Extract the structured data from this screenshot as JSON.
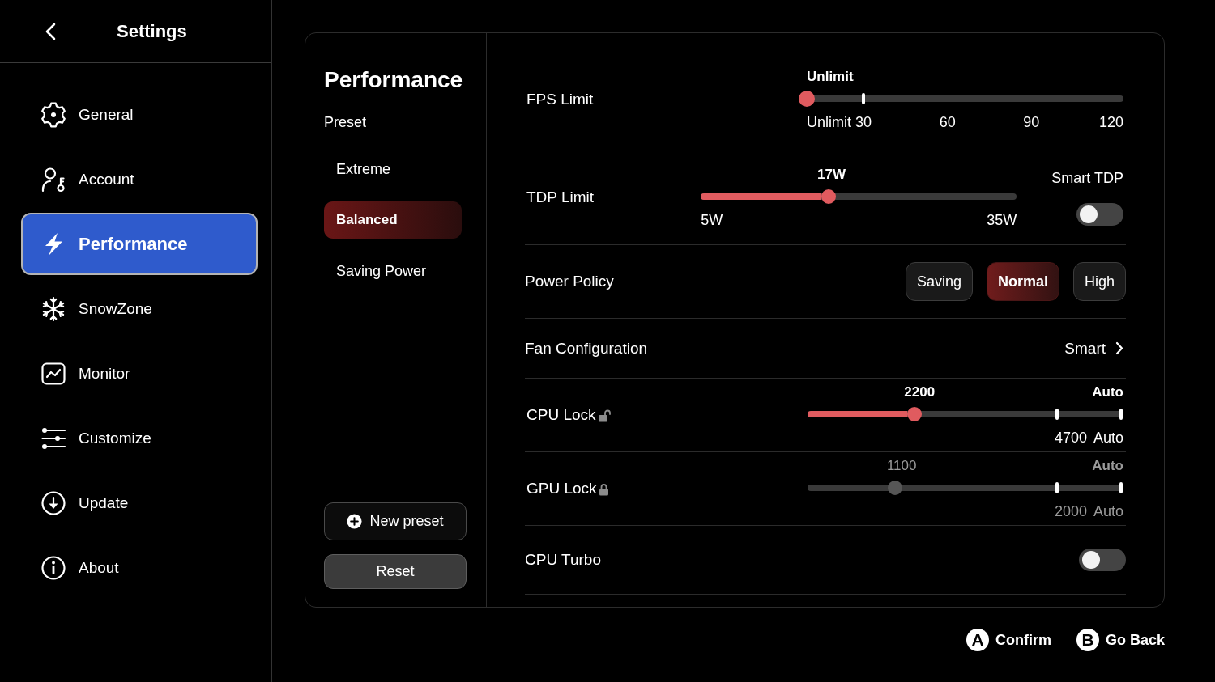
{
  "sidebar": {
    "title": "Settings",
    "items": [
      {
        "label": "General",
        "selected": false
      },
      {
        "label": "Account",
        "selected": false
      },
      {
        "label": "Performance",
        "selected": true
      },
      {
        "label": "SnowZone",
        "selected": false
      },
      {
        "label": "Monitor",
        "selected": false
      },
      {
        "label": "Customize",
        "selected": false
      },
      {
        "label": "Update",
        "selected": false
      },
      {
        "label": "About",
        "selected": false
      }
    ]
  },
  "presets": {
    "title": "Performance",
    "label": "Preset",
    "items": [
      {
        "label": "Extreme",
        "selected": false
      },
      {
        "label": "Balanced",
        "selected": true
      },
      {
        "label": "Saving Power",
        "selected": false
      }
    ],
    "buttons": [
      {
        "kind": "add",
        "label": "New preset"
      },
      {
        "kind": "reset",
        "label": "Reset"
      }
    ]
  },
  "settings": {
    "rows": [
      {
        "kind": "steps",
        "label": "FPS Limit",
        "value": "Unlimit",
        "level": 0,
        "scale": [
          {
            "kind": "label",
            "label": "Unlimit"
          },
          {
            "kind": "stop",
            "label": "30"
          },
          {
            "kind": "label",
            "label": "60"
          },
          {
            "kind": "label",
            "label": "90"
          },
          {
            "kind": "label",
            "label": "120"
          }
        ]
      },
      {
        "kind": "range",
        "label": "TDP Limit",
        "value": "17W",
        "level": 0.4,
        "scale": [
          {
            "kind": "label",
            "label": "5W"
          },
          {
            "kind": "label",
            "label": "35W"
          }
        ],
        "toggle": {
          "label": "Smart TDP",
          "on": false
        }
      },
      {
        "kind": "choice",
        "label": "Power Policy",
        "options": [
          {
            "label": "Saving",
            "selected": false
          },
          {
            "label": "Normal",
            "selected": true
          },
          {
            "label": "High",
            "selected": false
          }
        ]
      },
      {
        "kind": "link",
        "label": "Fan Configuration",
        "value": "Smart"
      },
      {
        "kind": "lock",
        "label": "CPU Lock",
        "locked": false,
        "disabled": false,
        "value": "2200",
        "end_value": "Auto",
        "level": 0.33,
        "scale": [
          {
            "kind": "stop",
            "label": "4700"
          },
          {
            "kind": "stop",
            "label": "Auto"
          }
        ]
      },
      {
        "kind": "lock",
        "label": "GPU Lock",
        "locked": true,
        "disabled": true,
        "value": "1100",
        "end_value": "Auto",
        "level": 0.265,
        "scale": [
          {
            "kind": "stop",
            "label": "2000"
          },
          {
            "kind": "stop",
            "label": "Auto"
          }
        ]
      },
      {
        "kind": "toggle",
        "label": "CPU Turbo",
        "on": false
      }
    ]
  },
  "hints": [
    {
      "key": "A",
      "label": "Confirm"
    },
    {
      "key": "B",
      "label": "Go Back"
    }
  ]
}
